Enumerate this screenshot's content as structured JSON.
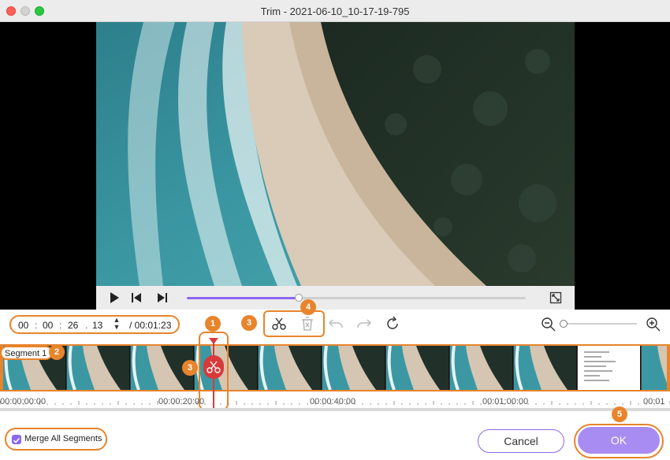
{
  "window": {
    "title": "Trim - 2021-06-10_10-17-19-795"
  },
  "player": {
    "progress_fraction": 0.33,
    "icons": [
      "play-icon",
      "step-back-icon",
      "step-forward-icon",
      "fullscreen-icon"
    ]
  },
  "time_input": {
    "hours": "00",
    "minutes": "00",
    "seconds": "26",
    "frames": "13",
    "sep1": ":",
    "sep2": ":",
    "sep3": ".",
    "total": "/ 00:01:23"
  },
  "toolbar": {
    "icons": [
      "scissors-icon",
      "delete-icon",
      "undo-icon",
      "redo-icon",
      "reset-icon",
      "zoom-out-icon",
      "zoom-in-icon"
    ],
    "zoom_level_fraction": 0.0
  },
  "badges": {
    "b1": "1",
    "b2": "2",
    "b3a": "3",
    "b3b": "3",
    "b4": "4",
    "b5": "5"
  },
  "timeline": {
    "segment_label": "Segment 1",
    "playhead_time": "00:00:26"
  },
  "ruler": {
    "labels": [
      "00:00:00:00",
      "00:00:20:00",
      "00:00:40:00",
      "00:01:00:00",
      "00:01"
    ]
  },
  "footer": {
    "merge_label": "Merge All Segments",
    "merge_checked": true,
    "cancel_label": "Cancel",
    "ok_label": "OK"
  },
  "colors": {
    "accent": "#8a68ee",
    "annotation": "#e8842c",
    "cut": "#d83a3a"
  }
}
